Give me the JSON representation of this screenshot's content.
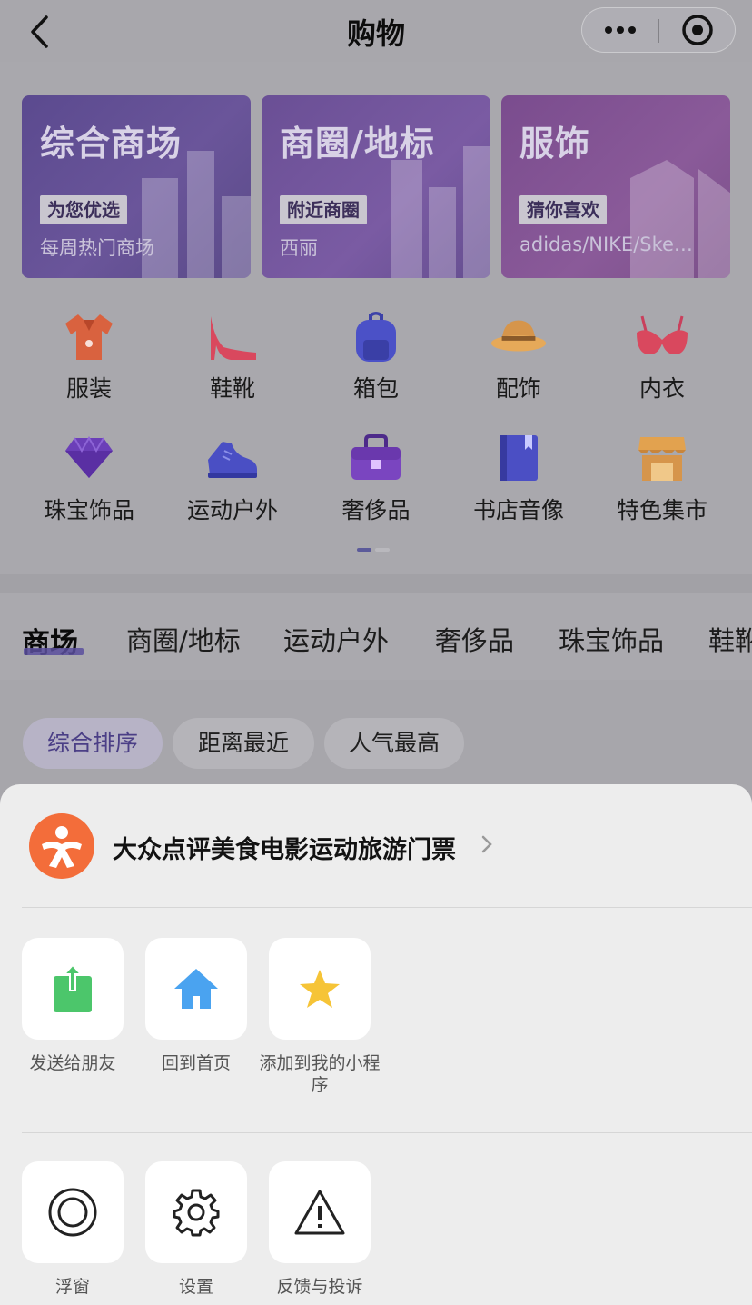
{
  "nav": {
    "title": "购物"
  },
  "banners": [
    {
      "title": "综合商场",
      "tag": "为您优选",
      "sub": "每周热门商场"
    },
    {
      "title": "商圈/地标",
      "tag": "附近商圈",
      "sub": "西丽"
    },
    {
      "title": "服饰",
      "tag": "猜你喜欢",
      "sub": "adidas/NIKE/Ske…"
    }
  ],
  "categories": [
    {
      "label": "服装",
      "icon": "shirt-icon"
    },
    {
      "label": "鞋靴",
      "icon": "high-heel-icon"
    },
    {
      "label": "箱包",
      "icon": "backpack-icon"
    },
    {
      "label": "配饰",
      "icon": "hat-icon"
    },
    {
      "label": "内衣",
      "icon": "bra-icon"
    },
    {
      "label": "珠宝饰品",
      "icon": "diamond-icon"
    },
    {
      "label": "运动户外",
      "icon": "sneaker-icon"
    },
    {
      "label": "奢侈品",
      "icon": "handbag-icon"
    },
    {
      "label": "书店音像",
      "icon": "book-icon"
    },
    {
      "label": "特色集市",
      "icon": "market-stall-icon"
    }
  ],
  "tabs": [
    "商场",
    "商圈/地标",
    "运动户外",
    "奢侈品",
    "珠宝饰品",
    "鞋靴"
  ],
  "sort": [
    "综合排序",
    "距离最近",
    "人气最高"
  ],
  "sheet": {
    "app_name": "大众点评美食电影运动旅游门票",
    "actions_row1": [
      {
        "label": "发送给朋友",
        "icon": "share-icon"
      },
      {
        "label": "回到首页",
        "icon": "home-icon"
      },
      {
        "label": "添加到我的小程序",
        "icon": "star-icon"
      }
    ],
    "actions_row2": [
      {
        "label": "浮窗",
        "icon": "float-window-icon"
      },
      {
        "label": "设置",
        "icon": "gear-icon"
      },
      {
        "label": "反馈与投诉",
        "icon": "warning-icon"
      }
    ]
  },
  "colors": {
    "accent": "#5b4f9e",
    "logo": "#f36d3a",
    "share_green": "#4cc66b",
    "home_blue": "#4aa3f0",
    "star_yellow": "#f6c437"
  }
}
